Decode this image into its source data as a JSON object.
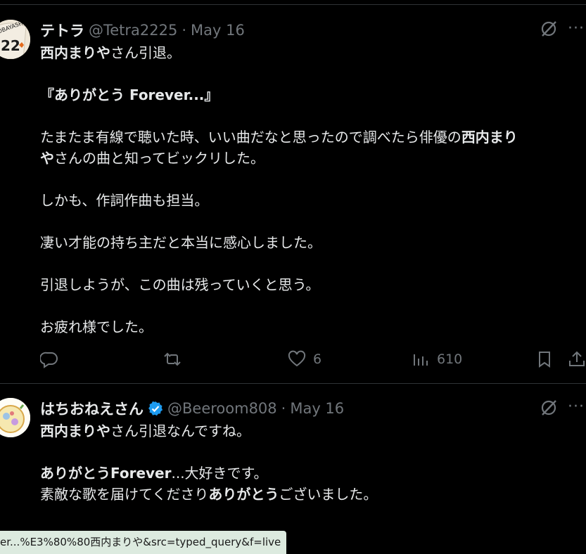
{
  "tweets": [
    {
      "name": "テトラ",
      "handle": "@Tetra2225",
      "separator": "·",
      "date": "May 16",
      "jersey_number": "22",
      "jersey_text": "KOBAYASHI",
      "body": {
        "l1_bold": "西内まりや",
        "l1_rest": "さん引退。",
        "l2": "『ありがとう Forever...』",
        "l3_a": "たまたま有線で聴いた時、いい曲だなと思ったので調べたら俳優の",
        "l3_bold": "西内まり",
        "l4_bold": "や",
        "l4_rest": "さんの曲と知ってビックリした。",
        "l5": "しかも、作詞作曲も担当。",
        "l6": "凄い才能の持ち主だと本当に感心しました。",
        "l7": "引退しようが、この曲は残っていくと思う。",
        "l8": "お疲れ様でした。"
      },
      "actions": {
        "reply_icon": "reply-icon",
        "retweet_icon": "retweet-icon",
        "like_icon": "heart-icon",
        "like_count": "6",
        "views_icon": "views-icon",
        "views_count": "610",
        "bookmark_icon": "bookmark-icon",
        "share_icon": "share-icon"
      }
    },
    {
      "name": "はちおねえさん",
      "handle": "@Beeroom808",
      "separator": "·",
      "date": "May 16",
      "verified": true,
      "body": {
        "l1_bold": "西内まりや",
        "l1_rest": "さん引退なんですね。",
        "l2_bold": "ありがとうForever",
        "l2_rest": "...大好きです。",
        "l3_a": "素敵な歌を届けてくださり",
        "l3_bold": "ありがとう",
        "l3_rest": "ございました。"
      }
    }
  ],
  "more_glyph": "···",
  "status_url": "er...%E3%80%80西内まりや&src=typed_query&f=live",
  "colors": {
    "background": "#000000",
    "text": "#e7e9ea",
    "muted": "#71767b",
    "divider": "#2f3336",
    "verified": "#1d9bf0"
  }
}
